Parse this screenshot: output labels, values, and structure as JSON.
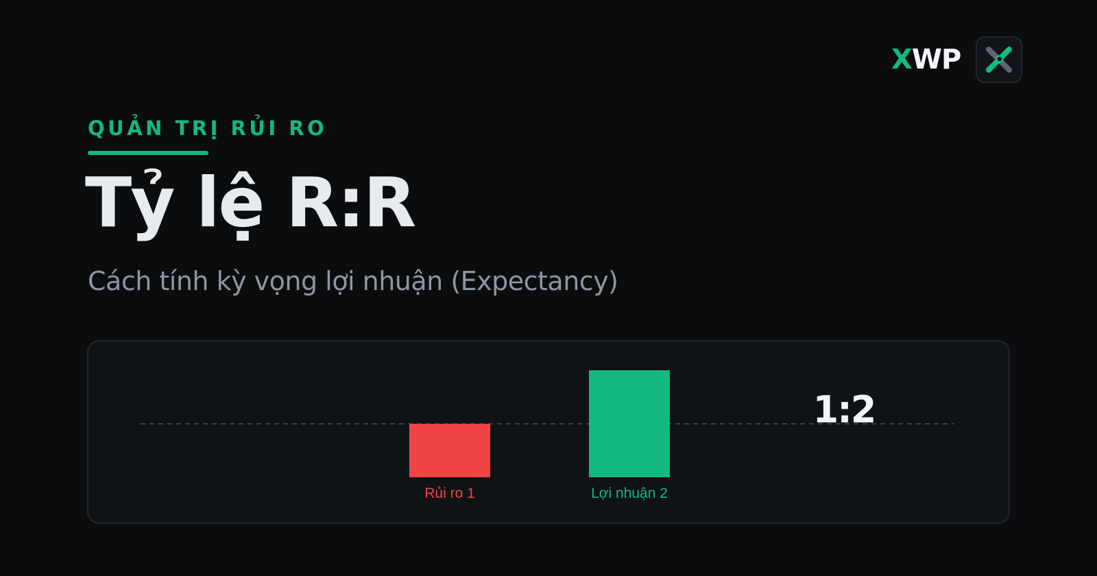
{
  "brand": {
    "logo_x": "X",
    "logo_wp": "WP",
    "icon": "x-logo-icon"
  },
  "header": {
    "eyebrow": "QUẢN TRỊ RỦI RO",
    "title": "Tỷ lệ R:R",
    "subtitle": "Cách tính kỳ vọng lợi nhuận (Expectancy)"
  },
  "colors": {
    "accent": "#12b981",
    "loss": "#ef4444",
    "background": "#0b0c0e",
    "panel": "#101316"
  },
  "chart_data": {
    "type": "bar",
    "categories": [
      "Rủi ro 1",
      "Lợi nhuận 2"
    ],
    "values": [
      -1,
      2
    ],
    "colors": [
      "#ef4444",
      "#12b981"
    ],
    "ratio_label": "1:2",
    "baseline": 0,
    "ylim": [
      -1,
      2
    ],
    "grid": false,
    "legend": "none"
  }
}
